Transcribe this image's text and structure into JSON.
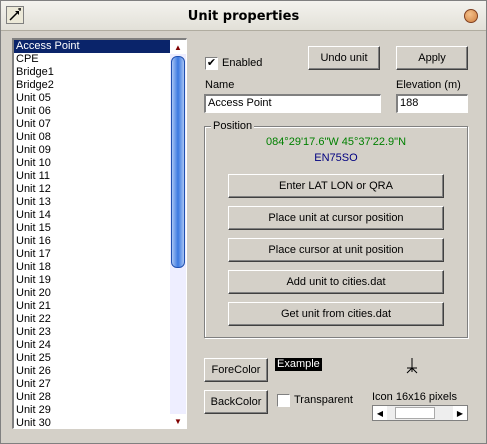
{
  "window": {
    "title": "Unit properties"
  },
  "units": {
    "items": [
      "Access Point",
      "CPE",
      "Bridge1",
      "Bridge2",
      "Unit 05",
      "Unit 06",
      "Unit 07",
      "Unit 08",
      "Unit 09",
      "Unit 10",
      "Unit 11",
      "Unit 12",
      "Unit 13",
      "Unit 14",
      "Unit 15",
      "Unit 16",
      "Unit 17",
      "Unit 18",
      "Unit 19",
      "Unit 20",
      "Unit 21",
      "Unit 22",
      "Unit 23",
      "Unit 24",
      "Unit 25",
      "Unit 26",
      "Unit 27",
      "Unit 28",
      "Unit 29",
      "Unit 30"
    ],
    "selected_index": 0
  },
  "form": {
    "enabled_label": "Enabled",
    "enabled_checked": true,
    "undo_label": "Undo unit",
    "apply_label": "Apply",
    "name_label": "Name",
    "name_value": "Access Point",
    "elevation_label": "Elevation (m)",
    "elevation_value": "188"
  },
  "position": {
    "group_label": "Position",
    "latlon": "084°29'17.6\"W 45°37'22.9\"N",
    "qra": "EN75SO",
    "latlon_color": "#008000",
    "qra_color": "#000080",
    "buttons": {
      "enter_latlon": "Enter LAT LON or QRA",
      "place_at_cursor": "Place unit at cursor position",
      "place_cursor": "Place cursor at unit position",
      "add_to_cities": "Add unit to cities.dat",
      "get_from_cities": "Get unit from cities.dat"
    }
  },
  "style": {
    "forecolor_label": "ForeColor",
    "backcolor_label": "BackColor",
    "example_label": "Example",
    "transparent_label": "Transparent",
    "transparent_checked": false,
    "icon_label": "Icon 16x16 pixels"
  }
}
